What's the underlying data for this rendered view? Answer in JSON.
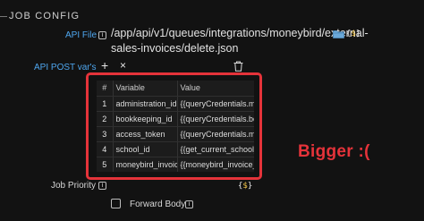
{
  "section": {
    "title": "JOB CONFIG"
  },
  "api_file": {
    "label": "API File",
    "value_line1": "/app/api/v1/queues/integrations/moneybird/external-",
    "value_line2": "sales-invoices/delete.json"
  },
  "post_vars": {
    "label": "API POST var's",
    "add_label": "+",
    "remove_label": "×",
    "columns": {
      "index": "#",
      "variable": "Variable",
      "value": "Value"
    },
    "rows": [
      {
        "index": "1",
        "variable": "administration_id",
        "value": "{{queryCredentials.moneybird_administration_id}}"
      },
      {
        "index": "2",
        "variable": "bookkeeping_id",
        "value": "{{queryCredentials.bookkeeping_id}}"
      },
      {
        "index": "3",
        "variable": "access_token",
        "value": "{{queryCredentials.moneybird_access_token}}"
      },
      {
        "index": "4",
        "variable": "school_id",
        "value": "{{get_current_school_id}}"
      },
      {
        "index": "5",
        "variable": "moneybird_invoice_id",
        "value": "{{moneybird_invoice_id}}"
      }
    ]
  },
  "job_priority": {
    "label": "Job Priority"
  },
  "forward_body": {
    "label": "Forward Body"
  },
  "annotation": {
    "text": "Bigger :(",
    "color": "#e5333a"
  },
  "icons": {
    "info": "i",
    "var": "{$}",
    "folder": "folder-icon",
    "trash": "trash-icon"
  },
  "colors": {
    "label_blue": "#4ea6ee",
    "background": "#121212",
    "highlight": "#e5333a"
  }
}
